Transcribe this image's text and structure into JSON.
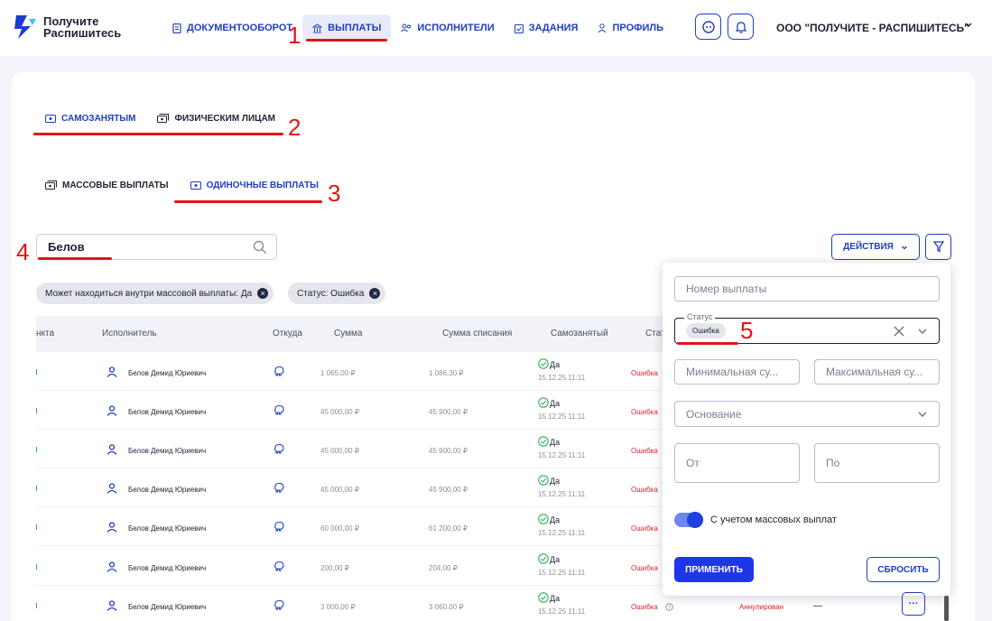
{
  "logo": {
    "line1": "Получите",
    "line2": "Распишитесь"
  },
  "nav": [
    {
      "label": "Документооборот",
      "icon": "document-icon"
    },
    {
      "label": "Выплаты",
      "icon": "bank-icon",
      "active": true
    },
    {
      "label": "Исполнители",
      "icon": "users-icon"
    },
    {
      "label": "Задания",
      "icon": "tasks-icon"
    },
    {
      "label": "Профиль",
      "icon": "profile-icon"
    }
  ],
  "org": "ООО \"ПОЛУЧИТЕ - РАСПИШИТЕСЬ\"",
  "tabs_level1": [
    {
      "label": "Самозанятым",
      "active": true
    },
    {
      "label": "Физическим лицам"
    }
  ],
  "tabs_level2": [
    {
      "label": "Массовые выплаты"
    },
    {
      "label": "Одиночные выплаты",
      "active": true
    }
  ],
  "search": {
    "value": "Белов"
  },
  "actions_label": "Действия",
  "chips": [
    {
      "label": "Может находиться внутри массовой выплаты: Да"
    },
    {
      "label": "Статус: Ошибка"
    }
  ],
  "table": {
    "headers": [
      "нкта",
      "Исполнитель",
      "Откуда",
      "Сумма",
      "Сумма списания",
      "Самозанятый",
      "Стат"
    ],
    "rows": [
      {
        "executor": "Белов Демид Юриевич",
        "sum": "1 065,00 ₽",
        "charge": "1 086,30 ₽",
        "self": "Да",
        "date": "15.12.25 11:11",
        "status": "Ошибка"
      },
      {
        "executor": "Белов Демид Юриевич",
        "sum": "45 000,00 ₽",
        "charge": "45 900,00 ₽",
        "self": "Да",
        "date": "15.12.25 11:11",
        "status": "Ошибка"
      },
      {
        "executor": "Белов Демид Юриевич",
        "sum": "45 000,00 ₽",
        "charge": "45 900,00 ₽",
        "self": "Да",
        "date": "15.12.25 11:11",
        "status": "Ошибка"
      },
      {
        "executor": "Белов Демид Юриевич",
        "sum": "45 000,00 ₽",
        "charge": "45 900,00 ₽",
        "self": "Да",
        "date": "15.12.25 11:11",
        "status": "Ошибка"
      },
      {
        "executor": "Белов Демид Юриевич",
        "sum": "60 000,00 ₽",
        "charge": "61 200,00 ₽",
        "self": "Да",
        "date": "15.12.25 11:11",
        "status": "Ошибка"
      },
      {
        "executor": "Белов Демид Юриевич",
        "sum": "200,00 ₽",
        "charge": "204,00 ₽",
        "self": "Да",
        "date": "15.12.25 11:11",
        "status": "Ошибка"
      },
      {
        "executor": "Белов Демид Юриевич",
        "sum": "3 000,00 ₽",
        "charge": "3 060,00 ₽",
        "self": "Да",
        "date": "15.12.25 11:11",
        "status": "Ошибка",
        "extra_status": "Аннулирован",
        "extra_dash": "—"
      }
    ]
  },
  "filter": {
    "number_placeholder": "Номер выплаты",
    "status_label": "Статус",
    "status_value": "Ошибка",
    "min_placeholder": "Минимальная су...",
    "max_placeholder": "Максимальная су...",
    "basis_placeholder": "Основание",
    "from_placeholder": "От",
    "to_placeholder": "По",
    "toggle_label": "С учетом массовых выплат",
    "toggle_on": true,
    "apply_label": "Применить",
    "reset_label": "Сбросить"
  },
  "annotations": [
    "1",
    "2",
    "3",
    "4",
    "5"
  ],
  "colors": {
    "accent": "#1f3fbf",
    "error": "#e0232f",
    "annotation": "#e01515"
  }
}
